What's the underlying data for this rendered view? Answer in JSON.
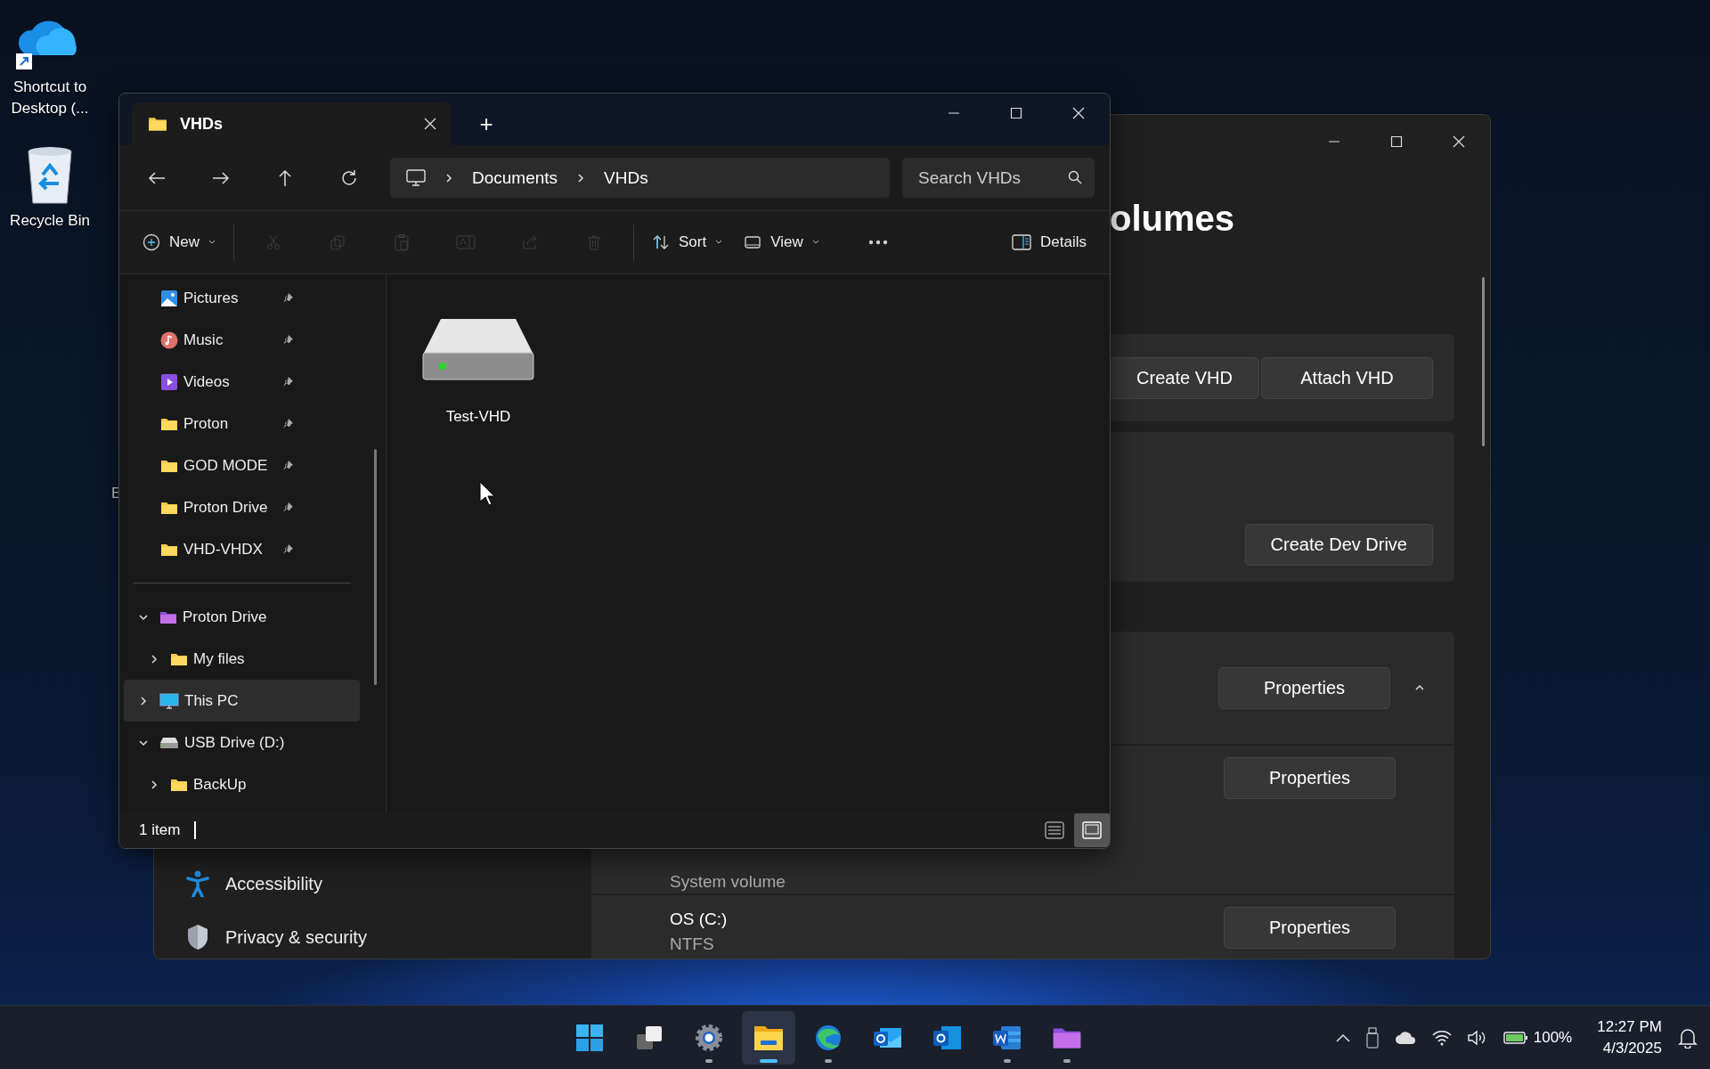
{
  "desktop": {
    "icons": [
      {
        "label": "Shortcut to Desktop (...",
        "kind": "cloud-shortcut"
      },
      {
        "label": "Recycle Bin",
        "kind": "recycle-bin"
      }
    ],
    "hidden_label": "E"
  },
  "settings": {
    "title": "olumes",
    "cards": [
      {
        "kind": "actions",
        "buttons": [
          "Create VHD",
          "Attach VHD"
        ]
      },
      {
        "kind": "actions-bottom",
        "buttons": [
          "Create Dev Drive"
        ]
      },
      {
        "kind": "disk",
        "buttons": [
          "Properties"
        ],
        "expanded": true
      },
      {
        "kind": "volume",
        "lines": [
          "System volume"
        ],
        "buttons": [
          "Properties"
        ]
      },
      {
        "kind": "volume",
        "lines": [
          "OS (C:)",
          "NTFS"
        ],
        "buttons": [
          "Properties"
        ]
      }
    ],
    "nav": [
      {
        "label": "Accessibility",
        "kind": "accessibility",
        "selected": false
      },
      {
        "label": "Privacy & security",
        "kind": "shield",
        "selected": false
      }
    ]
  },
  "explorer": {
    "tab": {
      "title": "VHDs"
    },
    "new_tab": "+",
    "breadcrumb": [
      "Documents",
      "VHDs"
    ],
    "search": {
      "placeholder": "Search VHDs"
    },
    "commands": [
      {
        "kind": "new",
        "label": "New",
        "disabled": false
      },
      {
        "kind": "cut",
        "disabled": true
      },
      {
        "kind": "copy",
        "disabled": true
      },
      {
        "kind": "paste",
        "disabled": true
      },
      {
        "kind": "rename",
        "disabled": true
      },
      {
        "kind": "share",
        "disabled": true
      },
      {
        "kind": "delete",
        "disabled": true
      },
      {
        "kind": "sort",
        "label": "Sort",
        "disabled": false
      },
      {
        "kind": "view",
        "label": "View",
        "disabled": false
      },
      {
        "kind": "more",
        "disabled": false
      }
    ],
    "details": "Details",
    "sidebar": {
      "pinned": [
        {
          "label": "Pictures",
          "kind": "pictures",
          "selected": false
        },
        {
          "label": "Music",
          "kind": "music",
          "selected": false
        },
        {
          "label": "Videos",
          "kind": "videos",
          "selected": false
        },
        {
          "label": "Proton",
          "kind": "folder",
          "selected": false
        },
        {
          "label": "GOD MODE",
          "kind": "folder",
          "selected": false
        },
        {
          "label": "Proton Drive",
          "kind": "folder",
          "selected": false
        },
        {
          "label": "VHD-VHDX",
          "kind": "folder",
          "selected": false
        }
      ],
      "tree": [
        {
          "label": "Proton Drive",
          "kind": "purple-folder",
          "expanded": true,
          "selected": false,
          "children": [
            {
              "label": "My files",
              "kind": "folder",
              "expanded": false,
              "selected": false
            }
          ]
        },
        {
          "label": "This PC",
          "kind": "monitor",
          "expanded": false,
          "selected": true
        },
        {
          "label": "USB Drive (D:)",
          "kind": "drive",
          "expanded": true,
          "selected": false,
          "children": [
            {
              "label": "BackUp",
              "kind": "folder",
              "expanded": false,
              "selected": false
            }
          ]
        }
      ]
    },
    "files": [
      {
        "name": "Test-VHD",
        "selected": false
      }
    ],
    "status": "1 item",
    "views": [
      {
        "kind": "details",
        "selected": false
      },
      {
        "kind": "tiles",
        "selected": true
      }
    ]
  },
  "taskbar": {
    "apps": [
      {
        "kind": "start",
        "running": false,
        "active": false
      },
      {
        "kind": "task-view",
        "running": false,
        "active": false
      },
      {
        "kind": "settings",
        "running": true,
        "active": false
      },
      {
        "kind": "explorer",
        "running": true,
        "active": true
      },
      {
        "kind": "edge",
        "running": true,
        "active": false
      },
      {
        "kind": "outlook-new",
        "running": false,
        "active": false
      },
      {
        "kind": "outlook",
        "running": false,
        "active": false
      },
      {
        "kind": "word",
        "running": true,
        "active": false
      },
      {
        "kind": "purple-folder",
        "running": true,
        "active": false
      }
    ],
    "battery": "100%",
    "time": "12:27 PM",
    "date": "4/3/2025"
  }
}
